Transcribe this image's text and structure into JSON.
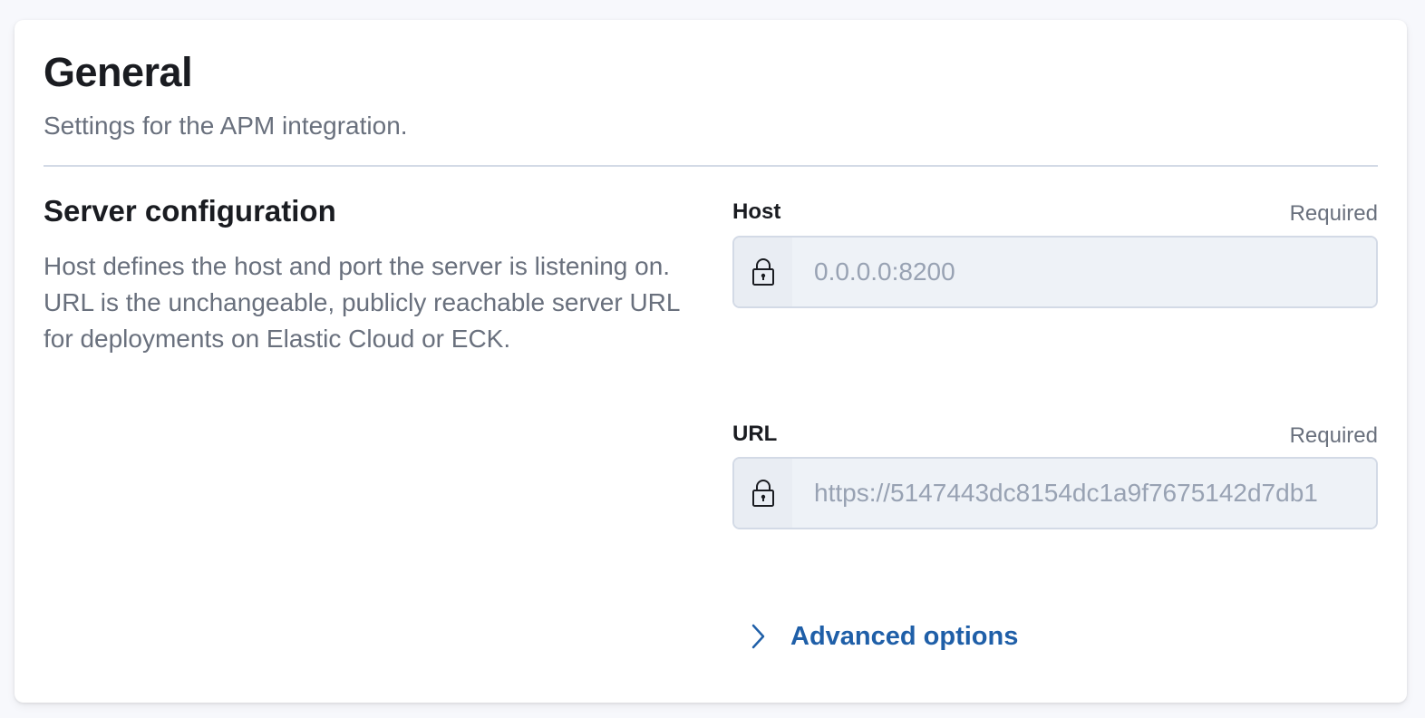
{
  "panel": {
    "title": "General",
    "subtitle": "Settings for the APM integration."
  },
  "server_config": {
    "title": "Server configuration",
    "description": "Host defines the host and port the server is listening on. URL is the unchangeable, publicly reachable server URL for deployments on Elastic Cloud or ECK."
  },
  "fields": {
    "host": {
      "label": "Host",
      "required_text": "Required",
      "value": "0.0.0.0:8200",
      "icon": "lock-icon"
    },
    "url": {
      "label": "URL",
      "required_text": "Required",
      "value": "https://5147443dc8154dc1a9f7675142d7db1",
      "icon": "lock-icon"
    }
  },
  "advanced": {
    "label": "Advanced options",
    "icon": "chevron-right-icon"
  },
  "colors": {
    "link": "#1f5fa8",
    "subdued_text": "#69707d",
    "border": "#d3dae6",
    "disabled_bg": "#eef2f7"
  }
}
